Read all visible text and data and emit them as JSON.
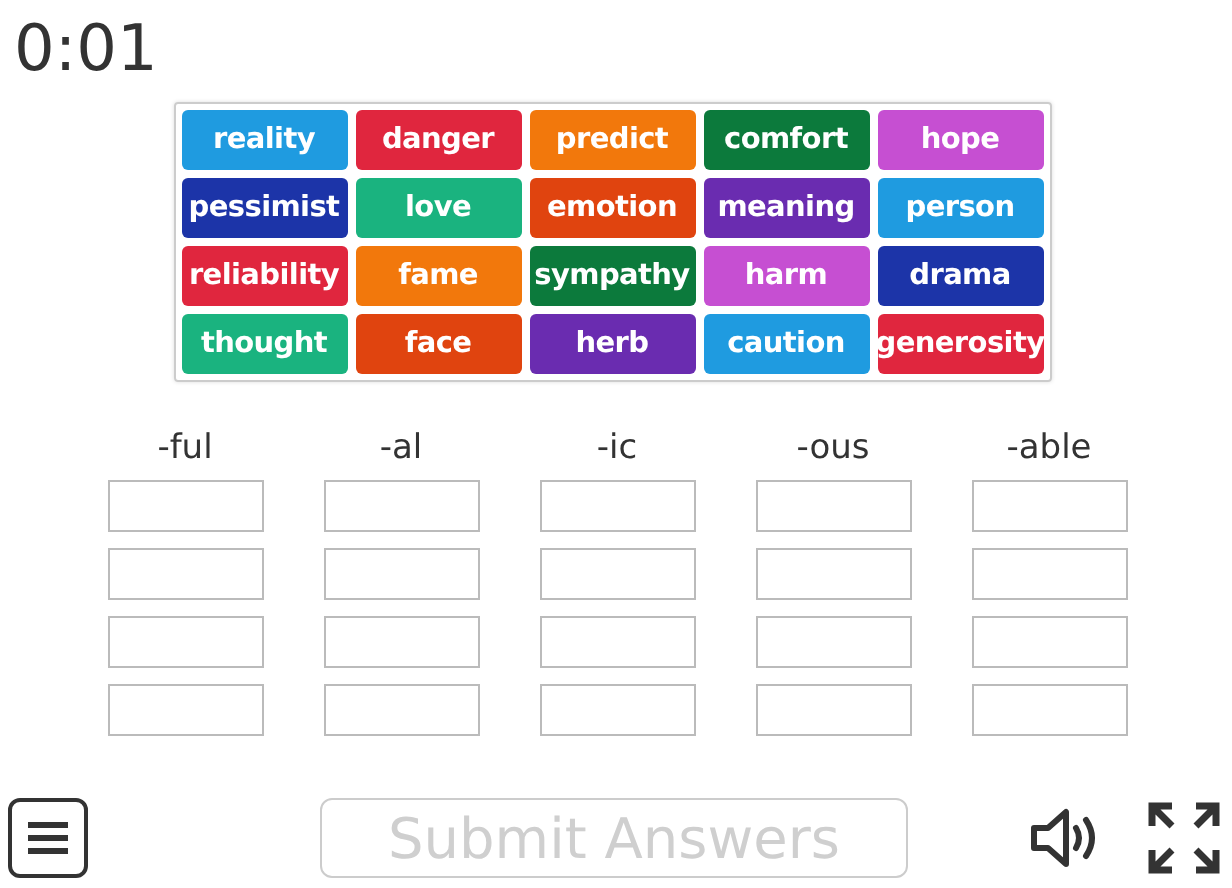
{
  "timer": "0:01",
  "tiles": [
    {
      "label": "reality",
      "color": "#1f9be0"
    },
    {
      "label": "danger",
      "color": "#e0263e"
    },
    {
      "label": "predict",
      "color": "#f2780c"
    },
    {
      "label": "comfort",
      "color": "#0c7a3c"
    },
    {
      "label": "hope",
      "color": "#c64fd2"
    },
    {
      "label": "pessimist",
      "color": "#1c34a8"
    },
    {
      "label": "love",
      "color": "#1ab37f"
    },
    {
      "label": "emotion",
      "color": "#e0440f"
    },
    {
      "label": "meaning",
      "color": "#6a2cb0"
    },
    {
      "label": "person",
      "color": "#1f9be0"
    },
    {
      "label": "reliability",
      "color": "#e0263e"
    },
    {
      "label": "fame",
      "color": "#f2780c"
    },
    {
      "label": "sympathy",
      "color": "#0c7a3c"
    },
    {
      "label": "harm",
      "color": "#c64fd2"
    },
    {
      "label": "drama",
      "color": "#1c34a8"
    },
    {
      "label": "thought",
      "color": "#1ab37f"
    },
    {
      "label": "face",
      "color": "#e0440f"
    },
    {
      "label": "herb",
      "color": "#6a2cb0"
    },
    {
      "label": "caution",
      "color": "#1f9be0"
    },
    {
      "label": "generosity",
      "color": "#e0263e"
    }
  ],
  "columns": [
    {
      "heading": "-ful",
      "slots": [
        {
          "empty": true
        },
        {
          "empty": true
        },
        {
          "empty": true
        },
        {
          "empty": true
        }
      ]
    },
    {
      "heading": "-al",
      "slots": [
        {
          "empty": true
        },
        {
          "empty": true
        },
        {
          "empty": true
        },
        {
          "empty": true
        }
      ]
    },
    {
      "heading": "-ic",
      "slots": [
        {
          "empty": true
        },
        {
          "empty": true
        },
        {
          "empty": true
        },
        {
          "empty": true
        }
      ]
    },
    {
      "heading": "-ous",
      "slots": [
        {
          "empty": true
        },
        {
          "empty": true
        },
        {
          "empty": true
        },
        {
          "empty": true
        }
      ]
    },
    {
      "heading": "-able",
      "slots": [
        {
          "empty": true
        },
        {
          "empty": true
        },
        {
          "empty": true
        },
        {
          "empty": true
        }
      ]
    }
  ],
  "submit": {
    "label": "Submit Answers",
    "disabled": true
  }
}
